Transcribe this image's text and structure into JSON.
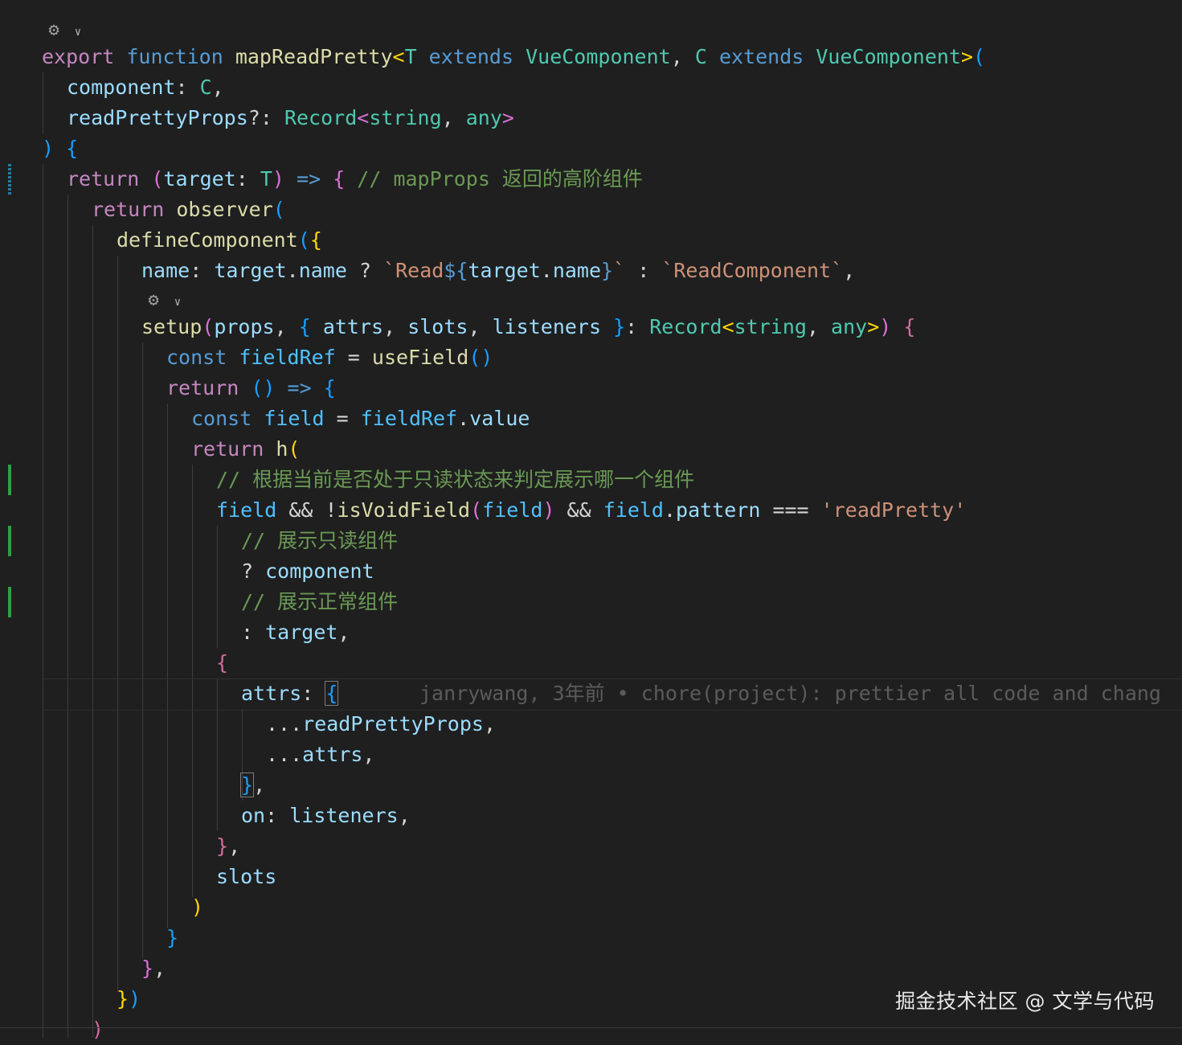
{
  "editor": {
    "language": "typescript",
    "lines": [
      [
        [
          "kw",
          "export "
        ],
        [
          "kw2",
          "function "
        ],
        [
          "fn",
          "mapReadPretty"
        ],
        [
          "b1",
          "<"
        ],
        [
          "typ",
          "T "
        ],
        [
          "kw2",
          "extends "
        ],
        [
          "typ",
          "VueComponent"
        ],
        [
          "pun",
          ", "
        ],
        [
          "typ",
          "C "
        ],
        [
          "kw2",
          "extends "
        ],
        [
          "typ",
          "VueComponent"
        ],
        [
          "b1",
          ">"
        ],
        [
          "b3",
          "("
        ]
      ],
      [
        [
          "var",
          "component"
        ],
        [
          "pun",
          ": "
        ],
        [
          "typ",
          "C"
        ],
        [
          "pun",
          ","
        ]
      ],
      [
        [
          "var",
          "readPrettyProps"
        ],
        [
          "pun",
          "?: "
        ],
        [
          "typ",
          "Record"
        ],
        [
          "b2",
          "<"
        ],
        [
          "typ",
          "string"
        ],
        [
          "pun",
          ", "
        ],
        [
          "typ",
          "any"
        ],
        [
          "b2",
          ">"
        ]
      ],
      [
        [
          "b3",
          ") {"
        ]
      ],
      [
        [
          "kw",
          "return "
        ],
        [
          "b2",
          "("
        ],
        [
          "var",
          "target"
        ],
        [
          "pun",
          ": "
        ],
        [
          "typ",
          "T"
        ],
        [
          "b2",
          ")"
        ],
        [
          "pun",
          " "
        ],
        [
          "kw2",
          "=> "
        ],
        [
          "b2",
          "{"
        ],
        [
          "cmt",
          " // mapProps 返回的高阶组件"
        ]
      ],
      [
        [
          "kw",
          "return "
        ],
        [
          "fn",
          "observer"
        ],
        [
          "b3",
          "("
        ]
      ],
      [
        [
          "fn",
          "defineComponent"
        ],
        [
          "b3",
          "("
        ],
        [
          "b1",
          "{"
        ]
      ],
      [
        [
          "var",
          "name"
        ],
        [
          "pun",
          ": "
        ],
        [
          "var",
          "target"
        ],
        [
          "pun",
          "."
        ],
        [
          "var",
          "name"
        ],
        [
          "pun",
          " ? "
        ],
        [
          "str",
          "`Read"
        ],
        [
          "kw2",
          "${"
        ],
        [
          "var",
          "target"
        ],
        [
          "pun",
          "."
        ],
        [
          "var",
          "name"
        ],
        [
          "kw2",
          "}"
        ],
        [
          "str",
          "`"
        ],
        [
          "pun",
          " : "
        ],
        [
          "str",
          "`ReadComponent`"
        ],
        [
          "pun",
          ","
        ]
      ],
      [
        [
          "fn",
          "setup"
        ],
        [
          "b2",
          "("
        ],
        [
          "var",
          "props"
        ],
        [
          "pun",
          ", "
        ],
        [
          "b3",
          "{ "
        ],
        [
          "var",
          "attrs"
        ],
        [
          "pun",
          ", "
        ],
        [
          "var",
          "slots"
        ],
        [
          "pun",
          ", "
        ],
        [
          "var",
          "listeners "
        ],
        [
          "b3",
          "}"
        ],
        [
          "pun",
          ": "
        ],
        [
          "typ",
          "Record"
        ],
        [
          "b1",
          "<"
        ],
        [
          "typ",
          "string"
        ],
        [
          "pun",
          ", "
        ],
        [
          "typ",
          "any"
        ],
        [
          "b1",
          ">"
        ],
        [
          "b2",
          ")"
        ],
        [
          "pun",
          " "
        ],
        [
          "mag",
          "{"
        ]
      ],
      [
        [
          "kw2",
          "const "
        ],
        [
          "cst",
          "fieldRef"
        ],
        [
          "pun",
          " = "
        ],
        [
          "fn",
          "useField"
        ],
        [
          "b3",
          "()"
        ]
      ],
      [
        [
          "kw",
          "return "
        ],
        [
          "b3",
          "() "
        ],
        [
          "kw2",
          "=> "
        ],
        [
          "b3",
          "{"
        ]
      ],
      [
        [
          "kw2",
          "const "
        ],
        [
          "cst",
          "field"
        ],
        [
          "pun",
          " = "
        ],
        [
          "cst",
          "fieldRef"
        ],
        [
          "pun",
          "."
        ],
        [
          "var",
          "value"
        ]
      ],
      [
        [
          "kw",
          "return "
        ],
        [
          "fn",
          "h"
        ],
        [
          "b1",
          "("
        ]
      ],
      [
        [
          "cmt",
          "// 根据当前是否处于只读状态来判定展示哪一个组件"
        ]
      ],
      [
        [
          "cst",
          "field"
        ],
        [
          "pun",
          " && !"
        ],
        [
          "fn",
          "isVoidField"
        ],
        [
          "b2",
          "("
        ],
        [
          "cst",
          "field"
        ],
        [
          "b2",
          ")"
        ],
        [
          "pun",
          " && "
        ],
        [
          "cst",
          "field"
        ],
        [
          "pun",
          "."
        ],
        [
          "var",
          "pattern"
        ],
        [
          "pun",
          " === "
        ],
        [
          "str",
          "'readPretty'"
        ]
      ],
      [
        [
          "cmt",
          "// 展示只读组件"
        ]
      ],
      [
        [
          "pun",
          "? "
        ],
        [
          "var",
          "component"
        ]
      ],
      [
        [
          "cmt",
          "// 展示正常组件"
        ]
      ],
      [
        [
          "pun",
          ": "
        ],
        [
          "var",
          "target"
        ],
        [
          "pun",
          ","
        ]
      ],
      [
        [
          "mag",
          "{"
        ]
      ],
      [
        [
          "var",
          "attrs"
        ],
        [
          "pun",
          ": "
        ],
        [
          "b3",
          "{"
        ]
      ],
      [
        [
          "pun",
          "..."
        ],
        [
          "var",
          "readPrettyProps"
        ],
        [
          "pun",
          ","
        ]
      ],
      [
        [
          "pun",
          "..."
        ],
        [
          "var",
          "attrs"
        ],
        [
          "pun",
          ","
        ]
      ],
      [
        [
          "b3",
          "}"
        ],
        [
          "pun",
          ","
        ]
      ],
      [
        [
          "var",
          "on"
        ],
        [
          "pun",
          ": "
        ],
        [
          "var",
          "listeners"
        ],
        [
          "pun",
          ","
        ]
      ],
      [
        [
          "mag",
          "}"
        ],
        [
          "pun",
          ","
        ]
      ],
      [
        [
          "var",
          "slots"
        ]
      ],
      [
        [
          "b1",
          ")"
        ]
      ],
      [
        [
          "b3",
          "}"
        ]
      ],
      [
        [
          "b2",
          "}"
        ],
        [
          "pun",
          ","
        ]
      ],
      [
        [
          "b1",
          "}"
        ],
        [
          "b3",
          ")"
        ]
      ],
      [
        [
          "mag",
          ")"
        ]
      ]
    ],
    "blame": "janrywang, 3年前 • chore(project): prettier all code and chang"
  },
  "watermark": "掘金技术社区 @ 文学与代码",
  "colors": {
    "background": "#1f1f1f",
    "keyword_control": "#c586c0",
    "keyword": "#569cd6",
    "function": "#dcdcaa",
    "type": "#4ec9b0",
    "variable": "#9cdcfe",
    "constant": "#4fc1ff",
    "string": "#ce9178",
    "comment": "#6a9955",
    "gutter_added": "#2ea043",
    "gutter_modified": "#1b81a8"
  }
}
